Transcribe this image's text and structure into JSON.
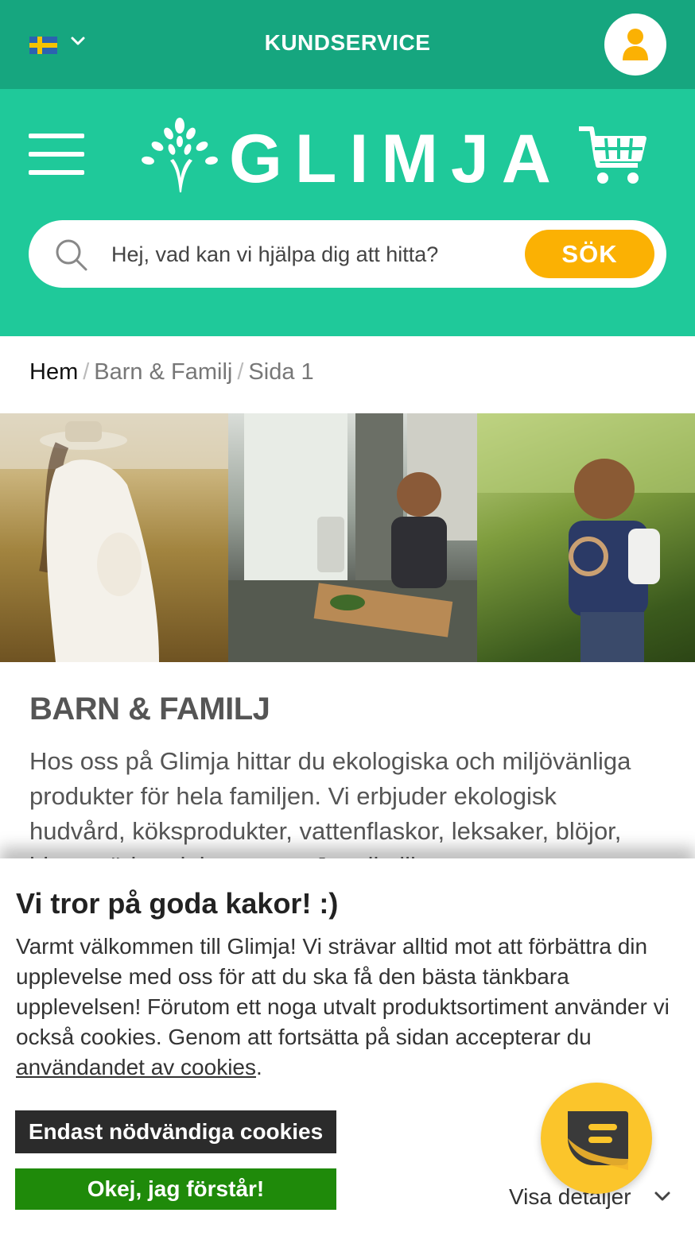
{
  "topbar": {
    "language_flag": "sweden-flag",
    "customer_service_label": "KUNDSERVICE",
    "account_icon": "user-icon",
    "colors": {
      "background": "#16a67f",
      "account_icon": "#fbb103"
    }
  },
  "header": {
    "menu_icon": "hamburger-menu-icon",
    "logo_text": "GLIMJA",
    "cart_icon": "shopping-cart-icon",
    "colors": {
      "background": "#1fc99a"
    }
  },
  "search": {
    "placeholder": "Hej, vad kan vi hjälpa dig att hitta?",
    "value": "",
    "button_label": "SÖK",
    "icon": "search-icon",
    "colors": {
      "button": "#fbb103"
    }
  },
  "breadcrumb": {
    "items": [
      "Hem",
      "Barn & Familj",
      "Sida 1"
    ],
    "separator": "/"
  },
  "category": {
    "title": "BARN & FAMILJ",
    "description": "Hos oss på Glimja hittar du ekologiska och miljövänliga produkter för hela familjen. Vi erbjuder ekologisk hudvård, köksprodukter, vattenflaskor, leksaker, blöjor, bitar, städprodukter, m.m. Ja, allt till"
  },
  "cookie_banner": {
    "title": "Vi tror på goda kakor! :)",
    "text": "Varmt välkommen till Glimja! Vi strävar alltid mot att förbättra din upplevelse med oss för att du ska få den bästa tänkbara upplevelsen! Förutom ett noga utvalt produktsortiment använder vi också cookies. Genom att fortsätta på sidan accepterar du ",
    "link_text": "användandet av cookies",
    "text_end": ".",
    "necessary_button": "Endast nödvändiga cookies",
    "accept_button": "Okej, jag förstår!",
    "details_label": "Visa detaljer",
    "colors": {
      "necessary_button": "#2b2b2b",
      "accept_button": "#1f8a0a"
    }
  },
  "chat": {
    "icon": "chat-bubble-icon",
    "color": "#fbc52b"
  }
}
